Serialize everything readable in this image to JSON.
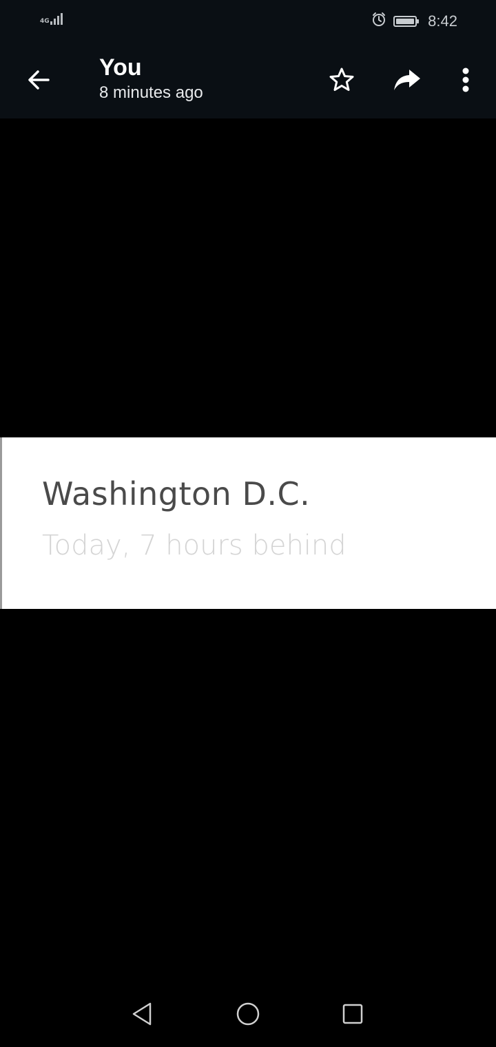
{
  "status_bar": {
    "network_type": "4G",
    "time": "8:42",
    "icons": [
      "signal-icon",
      "alarm-icon",
      "battery-icon"
    ]
  },
  "app_bar": {
    "sender": "You",
    "subtitle": "8 minutes ago",
    "icons": [
      "back-arrow-icon",
      "star-icon",
      "forward-icon",
      "more-vert-icon"
    ]
  },
  "media": {
    "city": "Washington D.C.",
    "time_difference": "Today, 7 hours behind"
  },
  "nav_bar": {
    "icons": [
      "nav-back-icon",
      "nav-home-icon",
      "nav-recents-icon"
    ]
  },
  "colors": {
    "bar_background": "#0a0f14",
    "viewer_background": "#000000",
    "card_background": "#ffffff",
    "city_text": "#4a4a4a",
    "subtext": "#d4d4d4"
  }
}
